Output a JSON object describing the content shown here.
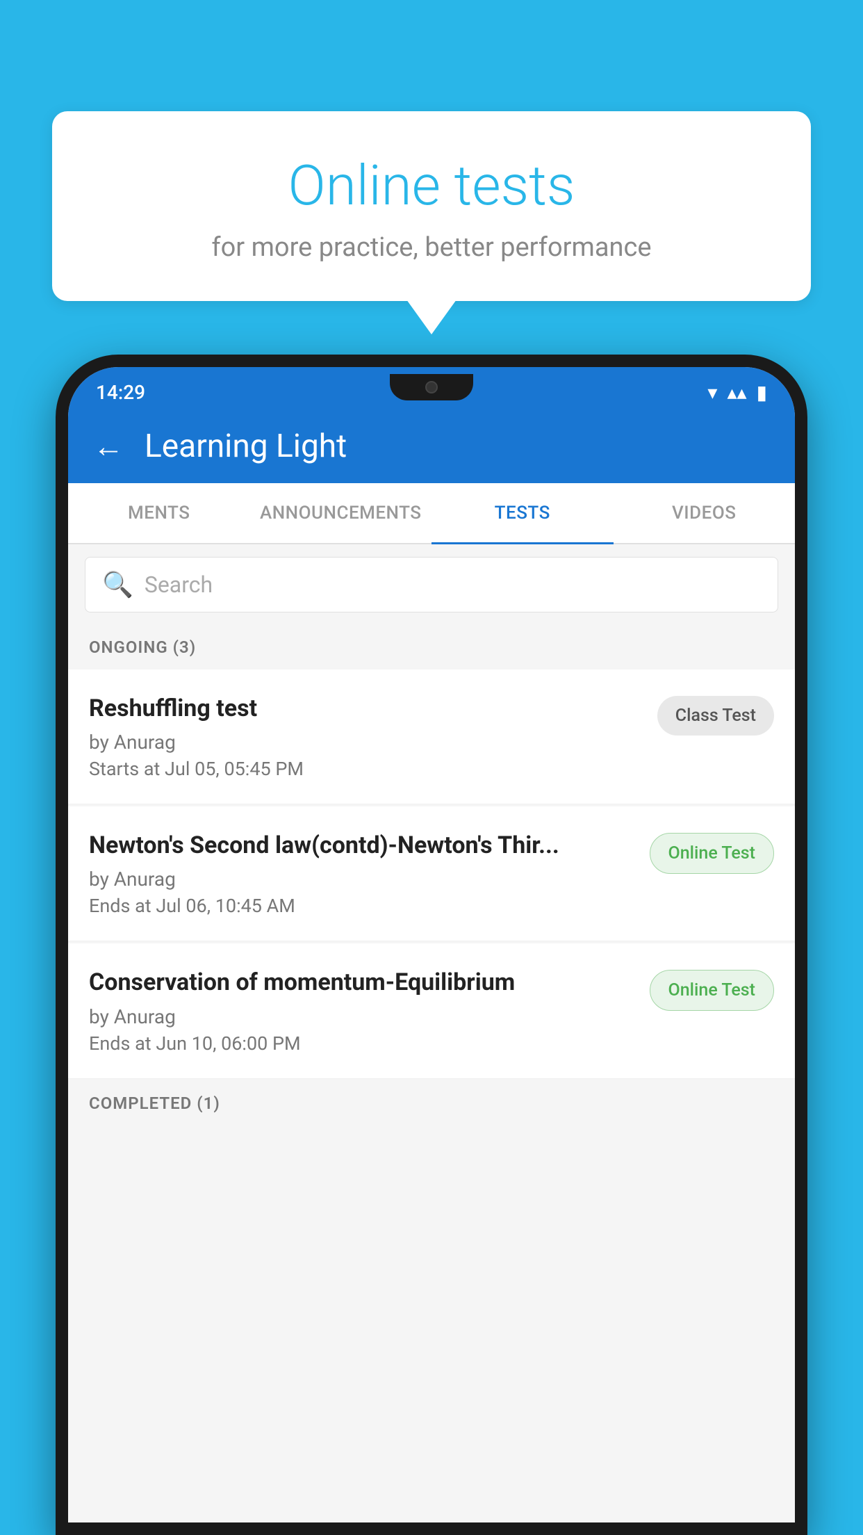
{
  "background": {
    "color": "#29b6e8"
  },
  "speech_bubble": {
    "title": "Online tests",
    "subtitle": "for more practice, better performance"
  },
  "status_bar": {
    "time": "14:29",
    "wifi": "▼",
    "signal": "▲",
    "battery": "▮"
  },
  "app_bar": {
    "title": "Learning Light",
    "back_label": "←"
  },
  "tabs": [
    {
      "label": "MENTS",
      "active": false
    },
    {
      "label": "ANNOUNCEMENTS",
      "active": false
    },
    {
      "label": "TESTS",
      "active": true
    },
    {
      "label": "VIDEOS",
      "active": false
    }
  ],
  "search": {
    "placeholder": "Search"
  },
  "ongoing_section": {
    "header": "ONGOING (3)",
    "tests": [
      {
        "title": "Reshuffling test",
        "author": "by Anurag",
        "date": "Starts at  Jul 05, 05:45 PM",
        "badge": "Class Test",
        "badge_type": "class"
      },
      {
        "title": "Newton's Second law(contd)-Newton's Thir...",
        "author": "by Anurag",
        "date": "Ends at  Jul 06, 10:45 AM",
        "badge": "Online Test",
        "badge_type": "online"
      },
      {
        "title": "Conservation of momentum-Equilibrium",
        "author": "by Anurag",
        "date": "Ends at  Jun 10, 06:00 PM",
        "badge": "Online Test",
        "badge_type": "online"
      }
    ]
  },
  "completed_section": {
    "header": "COMPLETED (1)"
  }
}
